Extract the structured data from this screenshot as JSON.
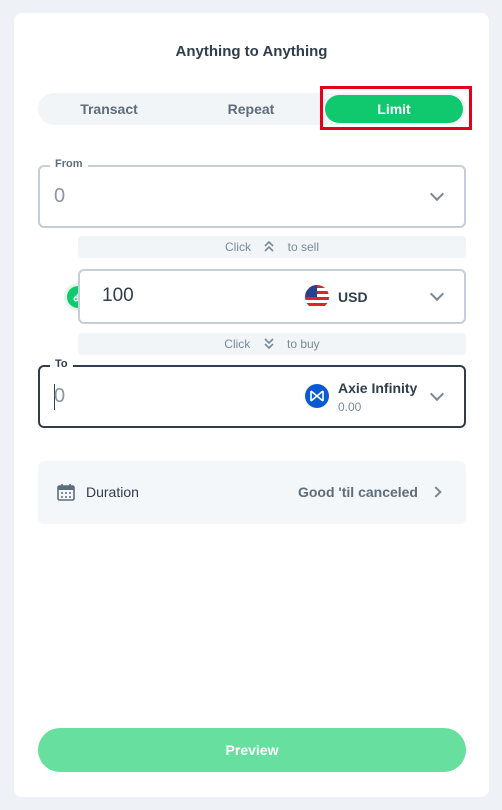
{
  "header": {
    "title": "Anything to Anything"
  },
  "tabs": [
    {
      "label": "Transact",
      "active": false
    },
    {
      "label": "Repeat",
      "active": false
    },
    {
      "label": "Limit",
      "active": true
    }
  ],
  "from": {
    "legend": "From",
    "value": "0"
  },
  "sell_hint": {
    "prefix": "Click",
    "suffix": "to sell",
    "icon": "double-chevron-up-icon"
  },
  "price": {
    "amount": "100",
    "currency": "USD",
    "icon": "us-flag-icon",
    "badge_icon": "link-icon"
  },
  "buy_hint": {
    "prefix": "Click",
    "suffix": "to buy",
    "icon": "double-chevron-down-icon"
  },
  "to": {
    "legend": "To",
    "value": "0",
    "asset_name": "Axie Infinity",
    "asset_balance": "0.00",
    "asset_icon": "axie-infinity-icon"
  },
  "duration": {
    "label": "Duration",
    "value": "Good 'til canceled",
    "icon": "calendar-icon"
  },
  "actions": {
    "preview_label": "Preview"
  },
  "colors": {
    "accent": "#10c96f",
    "preview_disabled": "#67e09f",
    "highlight": "#e3001b",
    "axie_blue": "#0a5bd1"
  }
}
